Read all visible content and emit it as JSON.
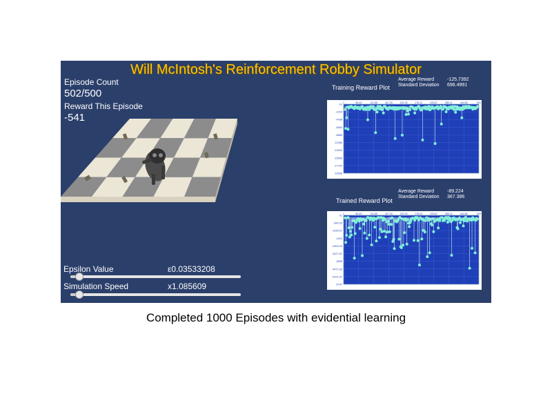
{
  "app": {
    "title": "Will McIntosh's Reinforcement Robby Simulator",
    "bg_color": "#2b3f6b",
    "title_color": "#f5c518"
  },
  "episode": {
    "label": "Episode Count",
    "value": "502/500"
  },
  "reward_episode": {
    "label": "Reward This Episode",
    "value": "-541"
  },
  "epsilon": {
    "label": "Epsilon Value",
    "value": "ε0.03533208",
    "slider_fraction": 0.03
  },
  "speed": {
    "label": "Simulation Speed",
    "value": "x1.085609",
    "slider_fraction": 0.03
  },
  "training_plot": {
    "title": "Training Reward Plot",
    "avg_label": "Average Reward",
    "avg_value": "-125.7392",
    "std_label": "Standard Deviation",
    "std_value": "696.4991",
    "x_ticks": [
      "1",
      "56.44",
      "111.88",
      "167.33",
      "222.78",
      "278.22",
      "333.67",
      "389.11",
      "444.56",
      "500"
    ],
    "y_ticks": [
      "-10",
      "-2224",
      "-4438",
      "-6652",
      "-8866",
      "-11080",
      "-13294",
      "-15508",
      "-17722",
      "-19936"
    ],
    "y_range": [
      -19936,
      -10
    ]
  },
  "trained_plot": {
    "title": "Trained Reward Plot",
    "avg_label": "Average Reward",
    "avg_value": "-89.224",
    "std_label": "Standard Deviation",
    "std_value": "367.386",
    "x_ticks": [
      "1",
      "56.44",
      "111.88",
      "167.33",
      "222.78",
      "278.22",
      "333.67",
      "389.11",
      "444.56",
      "500"
    ],
    "y_ticks": [
      "-11",
      "-840.33",
      "-1269.67",
      "-1923",
      "-2503.33",
      "-3227.67",
      "-3835",
      "-4472.33",
      "-5101.67",
      "-5747"
    ],
    "y_range": [
      -5747,
      -11
    ]
  },
  "colors": {
    "plot_bg": "#1f3fb8",
    "point": "#7ff0d8",
    "board_light": "#ece6d6",
    "board_dark": "#8c8c8c"
  },
  "caption": "Completed 1000 Episodes with evidential learning"
}
